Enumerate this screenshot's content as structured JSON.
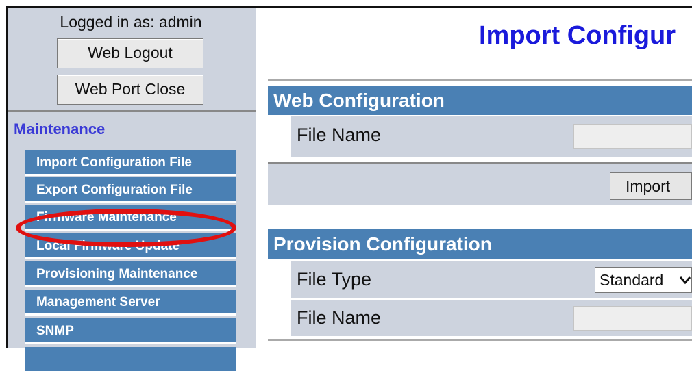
{
  "session": {
    "logged_in_text": "Logged in as: admin",
    "logout_label": "Web Logout",
    "port_close_label": "Web Port Close"
  },
  "sidebar": {
    "section_title": "Maintenance",
    "items": [
      {
        "label": "Import Configuration File"
      },
      {
        "label": "Export Configuration File"
      },
      {
        "label": "Firmware Maintenance"
      },
      {
        "label": "Local Firmware Update"
      },
      {
        "label": "Provisioning Maintenance"
      },
      {
        "label": "Management Server"
      },
      {
        "label": "SNMP"
      }
    ]
  },
  "main": {
    "page_title": "Import Configur",
    "web_config": {
      "heading": "Web Configuration",
      "file_name_label": "File Name",
      "import_label": "Import"
    },
    "provision_config": {
      "heading": "Provision Configuration",
      "file_type_label": "File Type",
      "file_type_value": "Standard",
      "file_name_label": "File Name"
    }
  },
  "colors": {
    "sidebar_bg": "#cdd3de",
    "menu_bg": "#4a80b4",
    "title_blue": "#1a1adb",
    "section_blue": "#3a3ad6",
    "highlight_red": "#e01010"
  }
}
